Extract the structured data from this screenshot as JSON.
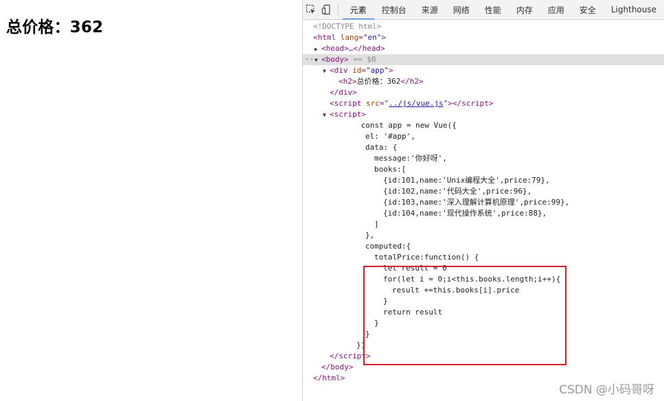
{
  "page": {
    "heading": "总价格：362"
  },
  "devtools": {
    "tabs": [
      "元素",
      "控制台",
      "来源",
      "网络",
      "性能",
      "内存",
      "应用",
      "安全",
      "Lighthouse"
    ],
    "active_tab": "元素",
    "dom": {
      "doctype": "<!DOCTYPE html>",
      "html_tag": "html",
      "html_lang_attr": "lang",
      "html_lang_val": "\"en\"",
      "head_collapsed": "<head>…</head>",
      "body_tag": "body",
      "body_marker": " == $0",
      "app_div_tag": "div",
      "app_div_attr": "id",
      "app_div_val": "\"app\"",
      "h2_text": "总价格：362",
      "script_src_attr": "src",
      "script_src_val": "../js/vue.js"
    },
    "script_lines": [
      "const app = new Vue({",
      "el: '#app',",
      "data: {",
      "message:'你好呀',",
      "books:[",
      "{id:101,name:'Unix编程大全',price:79},",
      "{id:102,name:'代码大全',price:96},",
      "{id:103,name:'深入理解计算机原理',price:99},",
      "{id:104,name:'现代操作系统',price:88},",
      "]",
      "},",
      "computed:{",
      "totalPrice:function() {",
      "let result = 0",
      "for(let i = 0;i<this.books.length;i++){",
      "result +=this.books[i].price",
      "}",
      "return result",
      "}",
      "}",
      "})"
    ]
  },
  "watermark": "CSDN @小码哥呀",
  "colors": {
    "highlight_box": "#d2232a",
    "active_tab_underline": "#1a73e8"
  }
}
